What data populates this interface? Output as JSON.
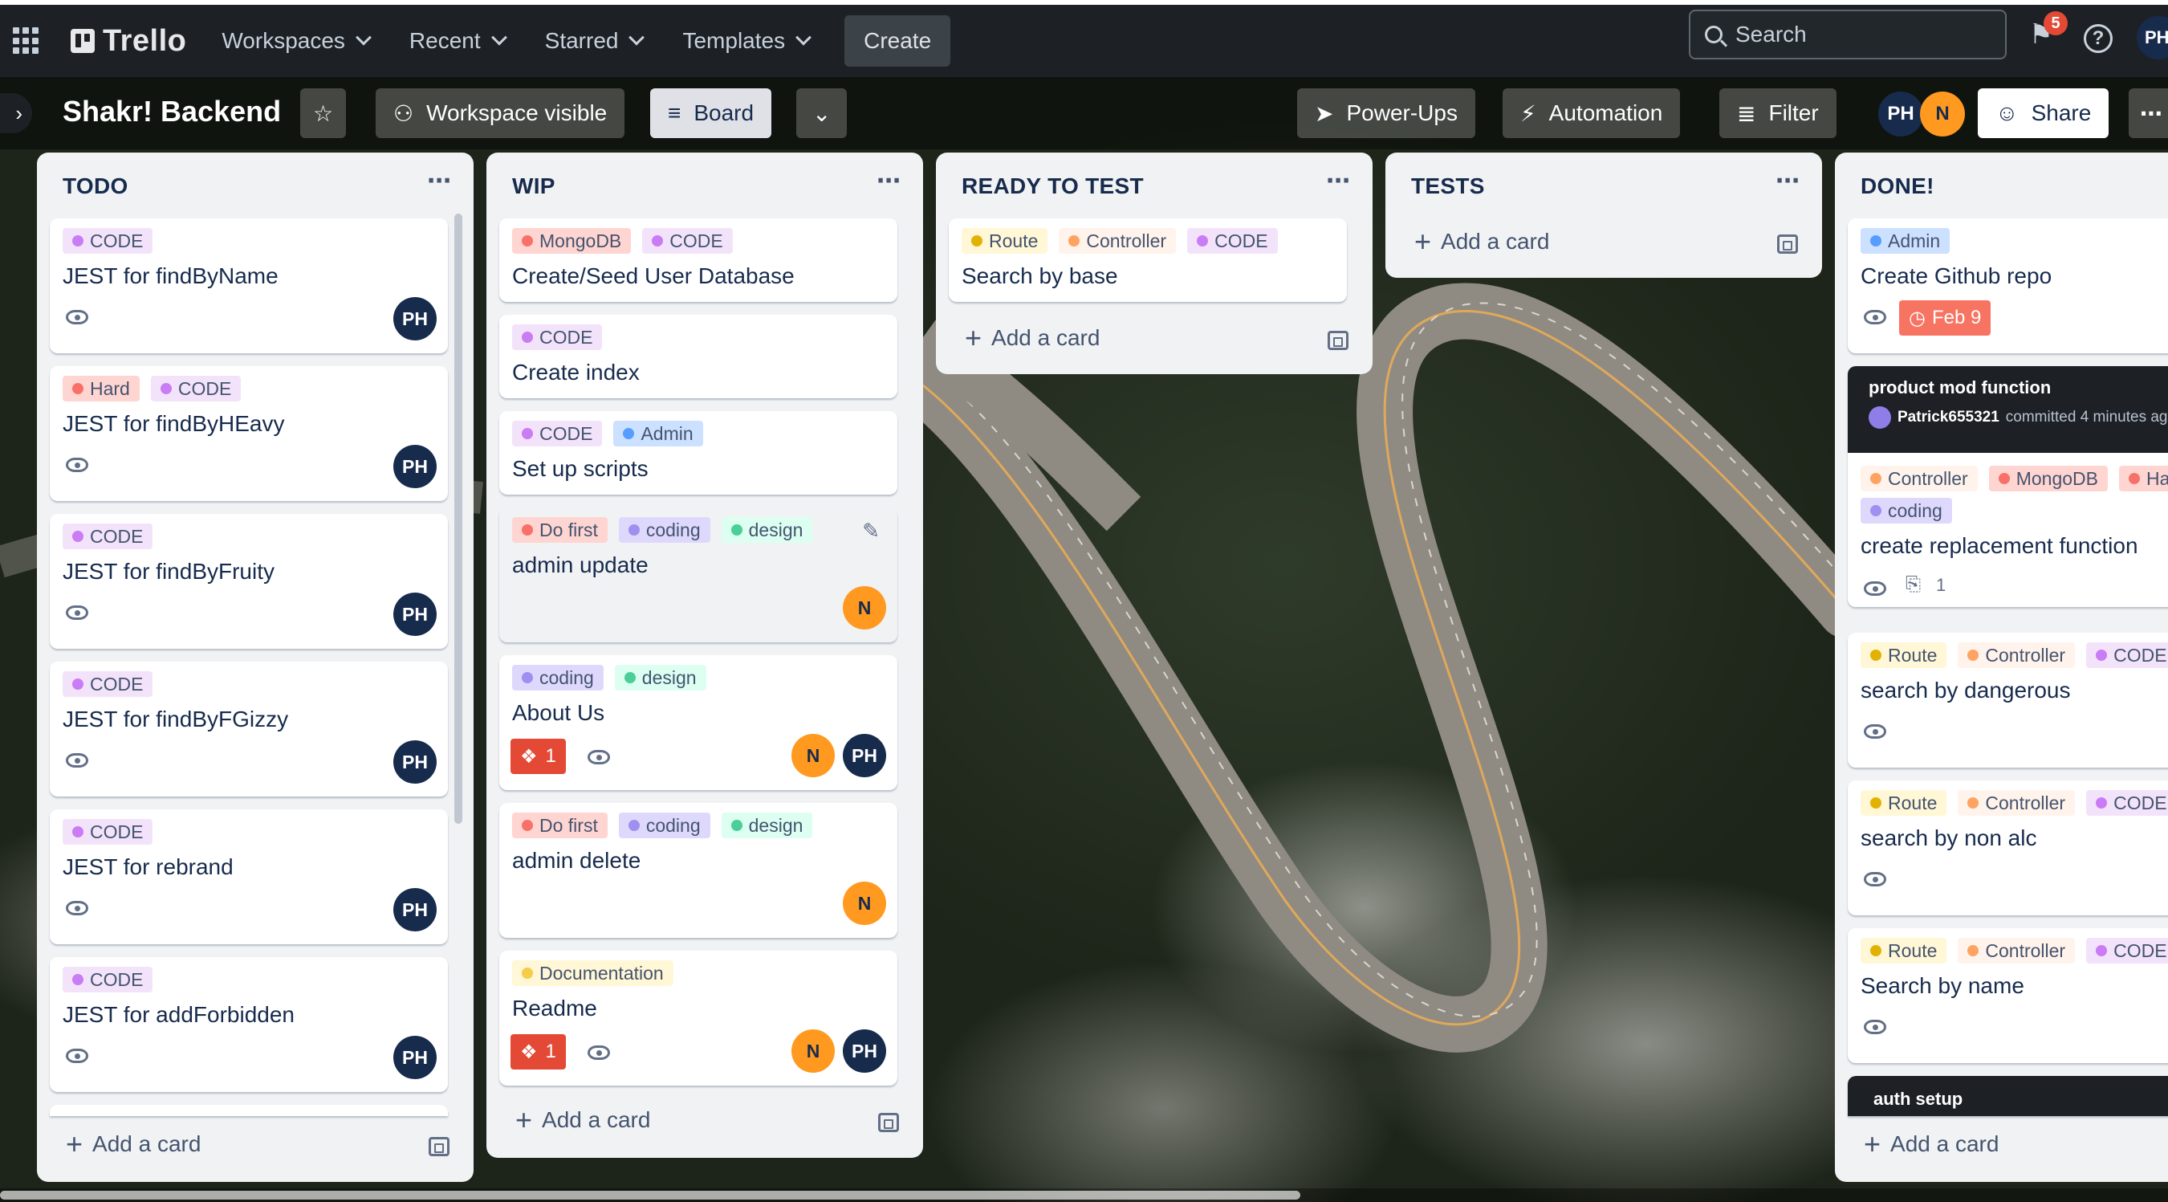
{
  "header": {
    "logo": "Trello",
    "nav": [
      "Workspaces",
      "Recent",
      "Starred",
      "Templates"
    ],
    "create": "Create",
    "search_placeholder": "Search",
    "notification_count": "5",
    "help": "?",
    "user_initials": "PH"
  },
  "board": {
    "title": "Shakr! Backend",
    "visibility": "Workspace visible",
    "view": "Board",
    "powerups": "Power-Ups",
    "automation": "Automation",
    "filter": "Filter",
    "members": [
      "PH",
      "N"
    ],
    "share": "Share"
  },
  "add_card_label": "Add a card",
  "lists": [
    {
      "title": "TODO",
      "cards": [
        {
          "labels": [
            "CODE"
          ],
          "title": "JEST for findByName",
          "avatars": [
            "PH"
          ]
        },
        {
          "labels": [
            "Hard",
            "CODE"
          ],
          "title": "JEST for findByHEavy",
          "avatars": [
            "PH"
          ]
        },
        {
          "labels": [
            "CODE"
          ],
          "title": "JEST for findByFruity",
          "avatars": [
            "PH"
          ]
        },
        {
          "labels": [
            "CODE"
          ],
          "title": "JEST for findByFGizzy",
          "avatars": [
            "PH"
          ]
        },
        {
          "labels": [
            "CODE"
          ],
          "title": "JEST for rebrand",
          "avatars": [
            "PH"
          ]
        },
        {
          "labels": [
            "CODE"
          ],
          "title": "JEST for addForbidden",
          "avatars": [
            "PH"
          ]
        }
      ]
    },
    {
      "title": "WIP",
      "cards": [
        {
          "labels": [
            "MongoDB",
            "CODE"
          ],
          "title": "Create/Seed User Database"
        },
        {
          "labels": [
            "CODE"
          ],
          "title": "Create index"
        },
        {
          "labels": [
            "CODE",
            "Admin"
          ],
          "title": "Set up scripts"
        },
        {
          "labels": [
            "Do first",
            "coding",
            "design"
          ],
          "title": "admin update",
          "avatars": [
            "N"
          ]
        },
        {
          "labels": [
            "coding",
            "design"
          ],
          "title": "About Us",
          "badge": "1",
          "avatars": [
            "N",
            "PH"
          ]
        },
        {
          "labels": [
            "Do first",
            "coding",
            "design"
          ],
          "title": "admin delete",
          "avatars": [
            "N"
          ]
        },
        {
          "labels": [
            "Documentation"
          ],
          "title": "Readme",
          "badge": "1",
          "avatars": [
            "N",
            "PH"
          ]
        }
      ]
    },
    {
      "title": "READY TO TEST",
      "cards": [
        {
          "labels": [
            "Route",
            "Controller",
            "CODE"
          ],
          "title": "Search by base"
        }
      ]
    },
    {
      "title": "TESTS",
      "cards": []
    },
    {
      "title": "DONE!",
      "cards": [
        {
          "labels": [
            "Admin"
          ],
          "title": "Create Github repo",
          "due": "Feb 9"
        },
        {
          "cover_title": "product mod function",
          "cover_user": "Patrick655321",
          "cover_text": "committed 4 minutes ag",
          "labels": [
            "Controller",
            "MongoDB",
            "Ha",
            "coding"
          ],
          "title": "create replacement function",
          "attachments": "1"
        },
        {
          "labels": [
            "Route",
            "Controller",
            "CODE"
          ],
          "title": "search by dangerous"
        },
        {
          "labels": [
            "Route",
            "Controller",
            "CODE"
          ],
          "title": "search by non alc"
        },
        {
          "labels": [
            "Route",
            "Controller",
            "CODE"
          ],
          "title": "Search by name"
        },
        {
          "cover_title": "auth setup"
        }
      ]
    }
  ],
  "label_colors": {
    "CODE": {
      "bg": "#f3e3fa",
      "dot": "#c97cf4"
    },
    "Hard": {
      "bg": "#ffd5d2",
      "dot": "#f87168"
    },
    "MongoDB": {
      "bg": "#ffd5d2",
      "dot": "#f87168"
    },
    "Admin": {
      "bg": "#cce0ff",
      "dot": "#579dff"
    },
    "Do first": {
      "bg": "#ffd5d2",
      "dot": "#f87168"
    },
    "coding": {
      "bg": "#dfd8fd",
      "dot": "#9f8fef"
    },
    "design": {
      "bg": "#dcfff1",
      "dot": "#4bce97"
    },
    "Documentation": {
      "bg": "#fff7d6",
      "dot": "#f5cd47"
    },
    "Route": {
      "bg": "#fff7d6",
      "dot": "#e2b203"
    },
    "Controller": {
      "bg": "#fff3eb",
      "dot": "#fea362"
    },
    "Ha": {
      "bg": "#ffd5d2",
      "dot": "#f87168"
    }
  }
}
